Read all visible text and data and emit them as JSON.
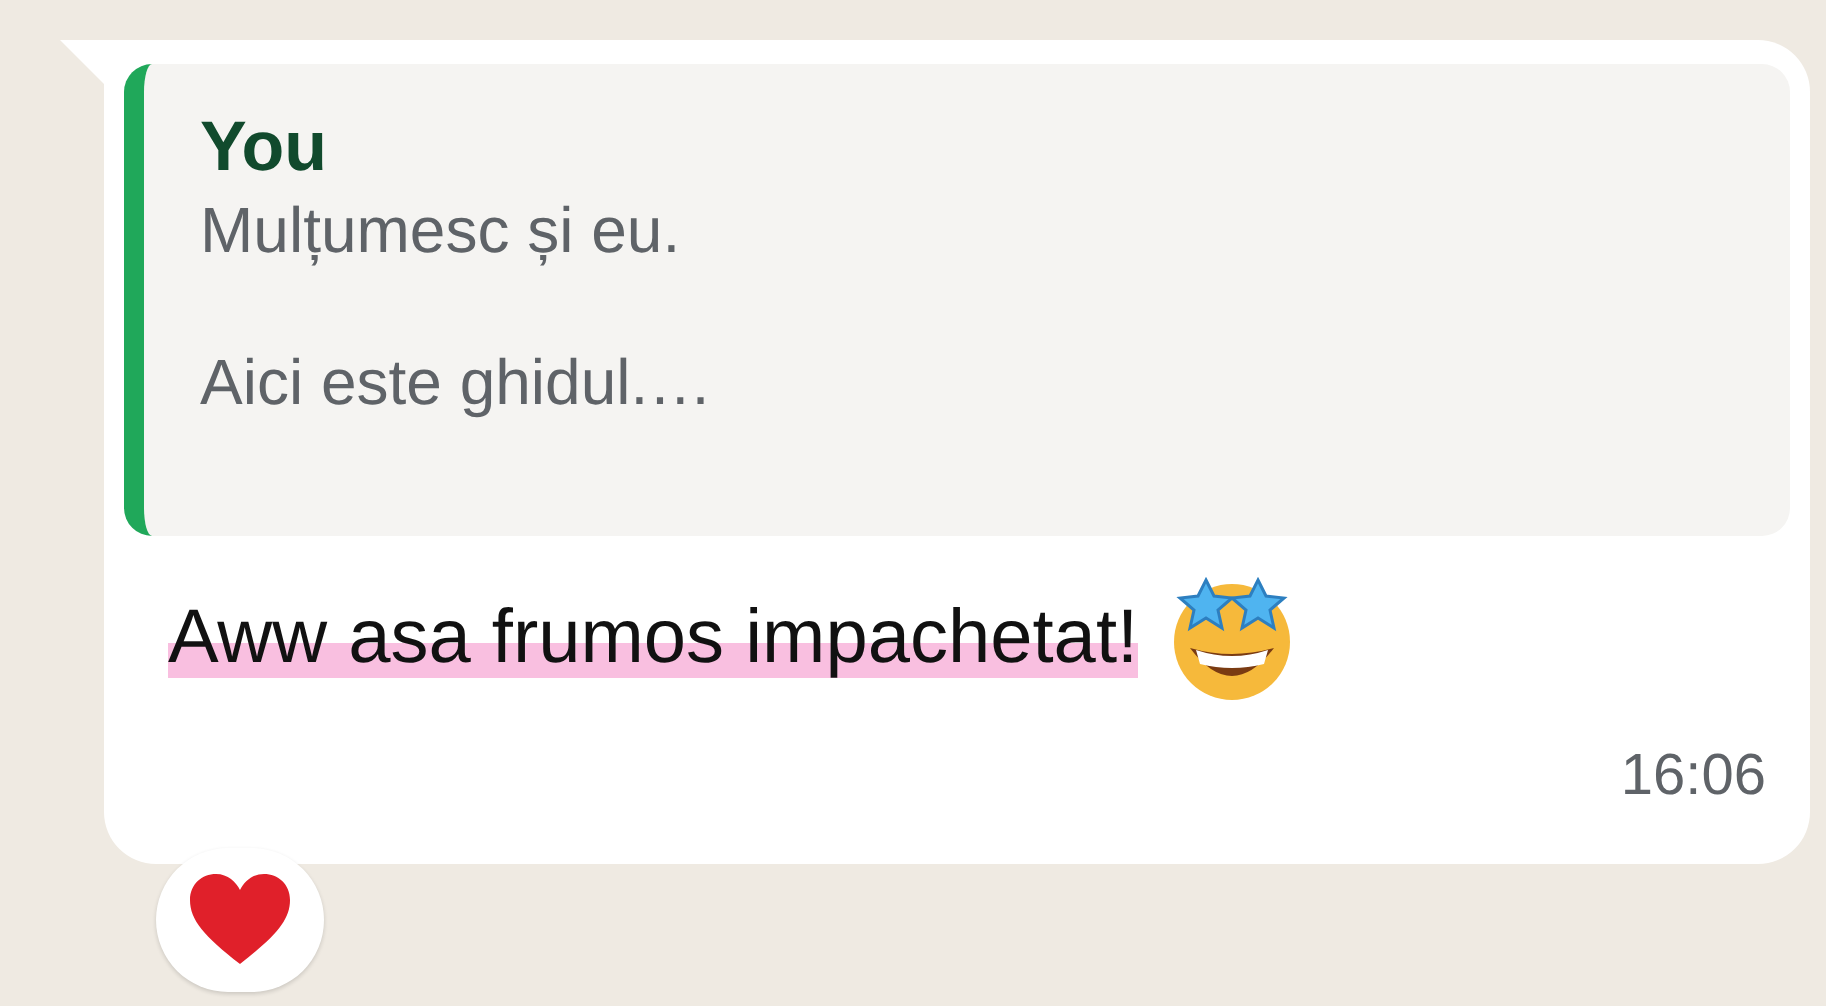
{
  "message": {
    "quote": {
      "author": "You",
      "paragraphs": [
        "Mulțumesc și eu.",
        "Aici este ghidul.…"
      ]
    },
    "text": "Aww asa frumos impachetat!",
    "highlighted": true,
    "time": "16:06"
  }
}
